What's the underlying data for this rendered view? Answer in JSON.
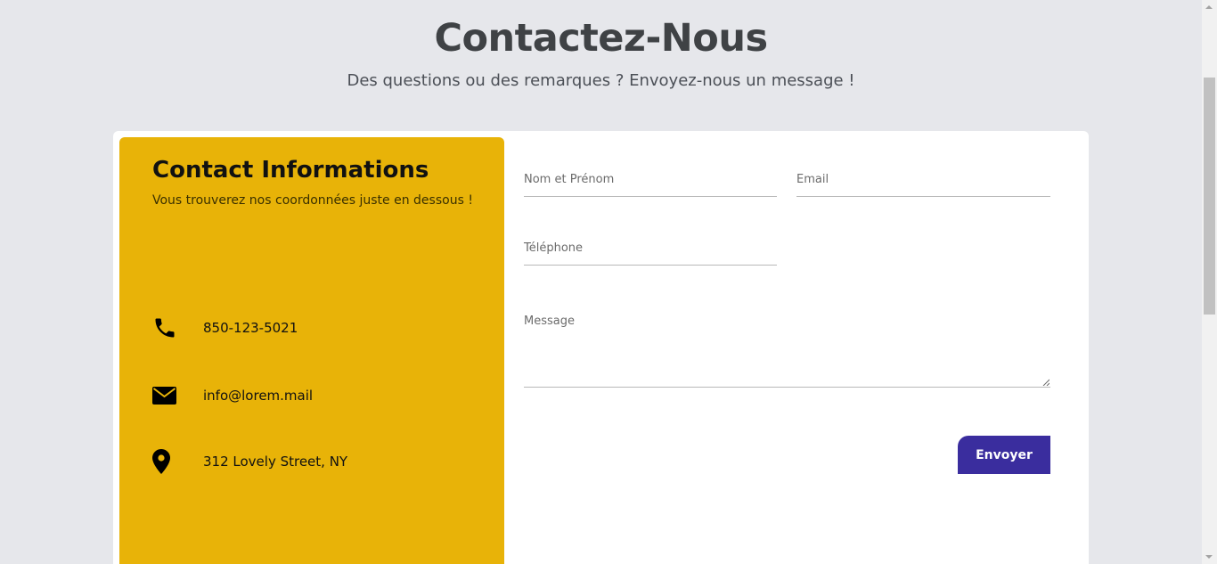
{
  "header": {
    "title": "Contactez-Nous",
    "subtitle": "Des questions ou des remarques ? Envoyez-nous un message !"
  },
  "info": {
    "title": "Contact Informations",
    "subtitle": "Vous trouverez nos coordonnées juste en dessous !",
    "phone": "850-123-5021",
    "email": "info@lorem.mail",
    "address": "312 Lovely Street, NY",
    "panel_color": "#e8b308"
  },
  "form": {
    "name_label": "Nom et Prénom",
    "email_label": "Email",
    "phone_label": "Téléphone",
    "message_label": "Message",
    "submit_label": "Envoyer",
    "submit_color": "#3a2d9e"
  },
  "icons": {
    "phone": "phone-icon",
    "email": "envelope-icon",
    "address": "map-pin-icon"
  }
}
